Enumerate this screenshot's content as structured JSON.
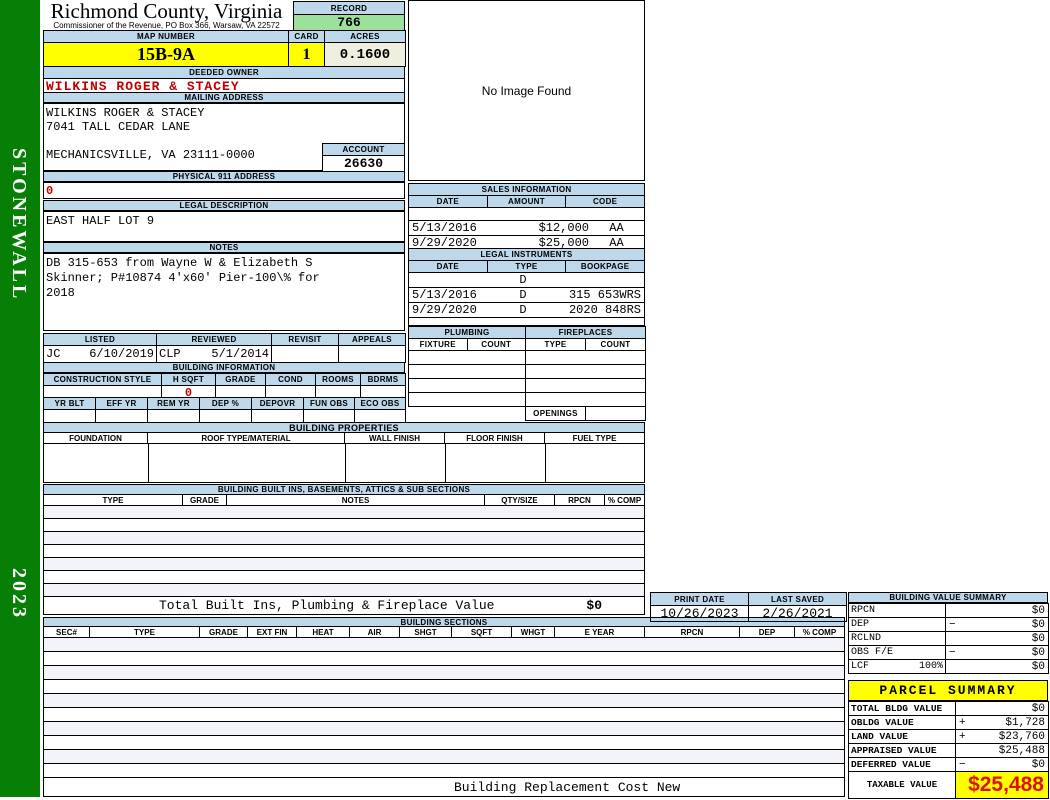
{
  "colors": {
    "sidebar_green": "#077F07",
    "header_blue": "#BCD8EA",
    "record_green": "#9CE09E",
    "yellow": "#FFFF00",
    "cream": "#EFEFE0",
    "red_text": "#C00000",
    "taxable_red": "#DD1100",
    "row_tint": "#F3F3FA"
  },
  "sidebar": {
    "district": "STONEWALL",
    "year": "2023"
  },
  "header": {
    "county": "Richmond County, Virginia",
    "commissioner_line": "Commissioner of the Revenue, PO Box 366, Warsaw, VA 22572"
  },
  "record": {
    "label": "RECORD",
    "value": "766"
  },
  "map_row": {
    "map_number_label": "MAP NUMBER",
    "map_number": "15B-9A",
    "card_label": "CARD",
    "card": "1",
    "acres_label": "ACRES",
    "acres": "0.1600"
  },
  "owner": {
    "label": "DEEDED OWNER",
    "name": "WILKINS ROGER & STACEY"
  },
  "mailing": {
    "label": "MAILING ADDRESS",
    "line1": "WILKINS ROGER & STACEY",
    "line2": "7041 TALL CEDAR LANE",
    "line3": "MECHANICSVILLE, VA 23111-0000",
    "account_label": "ACCOUNT",
    "account": "26630"
  },
  "physical_address": {
    "label": "PHYSICAL 911 ADDRESS",
    "value": "0"
  },
  "legal_description": {
    "label": "LEGAL DESCRIPTION",
    "value": "EAST HALF LOT 9"
  },
  "notes": {
    "label": "NOTES",
    "line1": "DB 315-653 from Wayne W & Elizabeth S",
    "line2": "Skinner; P#10874 4'x60' Pier-100\\% for",
    "line3": "2018"
  },
  "review": {
    "listed_label": "LISTED",
    "reviewed_label": "REVIEWED",
    "revisit_label": "REVISIT",
    "appeals_label": "APPEALS",
    "listed_by": "JC",
    "listed_date": "6/10/2019",
    "reviewed_by": "CLP",
    "reviewed_date": "5/1/2014"
  },
  "building_info": {
    "label": "BUILDING INFORMATION",
    "row1_headers": [
      "CONSTRUCTION STYLE",
      "H SQFT",
      "GRADE",
      "COND",
      "ROOMS",
      "BDRMS"
    ],
    "h_sqft": "0",
    "row2_headers": [
      "YR BLT",
      "EFF YR",
      "REM YR",
      "DEP %",
      "DEPOVR",
      "FUN OBS",
      "ECO OBS"
    ]
  },
  "image_box": {
    "text": "No Image Found"
  },
  "sales": {
    "label": "SALES INFORMATION",
    "headers": [
      "DATE",
      "AMOUNT",
      "CODE"
    ],
    "rows": [
      {
        "date": "5/13/2016",
        "amount": "$12,000",
        "code": "AA"
      },
      {
        "date": "9/29/2020",
        "amount": "$25,000",
        "code": "AA"
      }
    ]
  },
  "legal_instruments": {
    "label": "LEGAL INSTRUMENTS",
    "headers": [
      "DATE",
      "TYPE",
      "BOOKPAGE"
    ],
    "rows": [
      {
        "date": "",
        "type": "D",
        "bookpage": ""
      },
      {
        "date": "5/13/2016",
        "type": "D",
        "bookpage": "315 653WRS"
      },
      {
        "date": "9/29/2020",
        "type": "D",
        "bookpage": "2020 848RS"
      }
    ]
  },
  "plumbing": {
    "label": "PLUMBING",
    "fixture_label": "FIXTURE",
    "count_label": "COUNT"
  },
  "fireplaces": {
    "label": "FIREPLACES",
    "type_label": "TYPE",
    "count_label": "COUNT",
    "openings_label": "OPENINGS"
  },
  "building_properties": {
    "label": "BUILDING PROPERTIES",
    "headers": [
      "FOUNDATION",
      "ROOF TYPE/MATERIAL",
      "WALL FINISH",
      "FLOOR FINISH",
      "FUEL TYPE"
    ]
  },
  "built_ins": {
    "label": "BUILDING BUILT INS, BASEMENTS, ATTICS & SUB SECTIONS",
    "headers": [
      "TYPE",
      "GRADE",
      "NOTES",
      "QTY/SIZE",
      "RPCN",
      "% COMP"
    ],
    "total_label": "Total Built Ins, Plumbing & Fireplace Value",
    "total_value": "$0"
  },
  "print_info": {
    "print_date_label": "PRINT DATE",
    "print_date": "10/26/2023",
    "last_saved_label": "LAST SAVED",
    "last_saved": "2/26/2021"
  },
  "building_sections": {
    "label": "BUILDING SECTIONS",
    "headers": [
      "SEC#",
      "TYPE",
      "GRADE",
      "EXT FIN",
      "HEAT",
      "AIR",
      "SHGT",
      "SQFT",
      "WHGT",
      "E YEAR",
      "RPCN",
      "DEP",
      "% COMP"
    ],
    "footer": "Building Replacement Cost New"
  },
  "building_value_summary": {
    "label": "BUILDING VALUE SUMMARY",
    "rows": [
      {
        "name": "RPCN",
        "pct": "",
        "op": "",
        "value": "$0"
      },
      {
        "name": "DEP",
        "pct": "",
        "op": "−",
        "value": "$0"
      },
      {
        "name": "RCLND",
        "pct": "",
        "op": "",
        "value": "$0"
      },
      {
        "name": "OBS F/E",
        "pct": "",
        "op": "−",
        "value": "$0"
      },
      {
        "name": "LCF",
        "pct": "100%",
        "op": "",
        "value": "$0"
      }
    ]
  },
  "parcel_summary": {
    "label": "PARCEL SUMMARY",
    "rows": [
      {
        "name": "TOTAL BLDG VALUE",
        "op": "",
        "value": "$0"
      },
      {
        "name": "OBLDG VALUE",
        "op": "+",
        "value": "$1,728"
      },
      {
        "name": "LAND VALUE",
        "op": "+",
        "value": "$23,760"
      },
      {
        "name": "APPRAISED VALUE",
        "op": "",
        "value": "$25,488"
      },
      {
        "name": "DEFERRED VALUE",
        "op": "−",
        "value": "$0"
      }
    ],
    "taxable_label": "TAXABLE VALUE",
    "taxable_value": "$25,488"
  }
}
